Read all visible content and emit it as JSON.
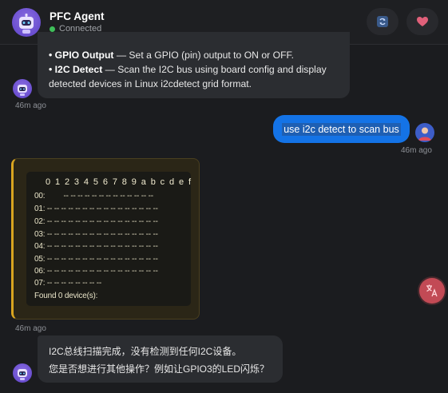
{
  "header": {
    "title": "PFC Agent",
    "status": "Connected",
    "status_color": "#3fbf5a",
    "refresh_icon": "refresh-icon",
    "heart_icon": "heart-icon"
  },
  "messages": {
    "bot_intro": {
      "item1_label": "• GPIO Output",
      "item1_text": " — Set a GPIO (pin) output to ON or OFF.",
      "item2_label": "• I2C Detect",
      "item2_text_line1": " — Scan the I2C bus using board config and display",
      "item2_text_line2": "detected devices in Linux i2cdetect grid format.",
      "time": "46m ago"
    },
    "user_msg": {
      "text": "use i2c detect to scan bus",
      "time": "46m ago"
    },
    "tool_result": {
      "header": "0 1 2 3 4 5 6 7 8 9 a b c d e f",
      "rows": [
        "00:         -- -- -- -- -- -- -- -- -- -- -- -- --",
        "01: -- -- -- -- -- -- -- -- -- -- -- -- -- -- -- --",
        "02: -- -- -- -- -- -- -- -- -- -- -- -- -- -- -- --",
        "03: -- -- -- -- -- -- -- -- -- -- -- -- -- -- -- --",
        "04: -- -- -- -- -- -- -- -- -- -- -- -- -- -- -- --",
        "05: -- -- -- -- -- -- -- -- -- -- -- -- -- -- -- --",
        "06: -- -- -- -- -- -- -- -- -- -- -- -- -- -- -- --",
        "07: -- -- -- -- -- -- -- --"
      ],
      "found": "Found 0 device(s):",
      "time": "46m ago"
    },
    "bot_reply": {
      "line1": "I2C总线扫描完成，没有检测到任何I2C设备。",
      "line2": "您是否想进行其他操作？例如让GPIO3的LED闪烁？"
    }
  },
  "translate_button": {
    "icon": "translate-icon",
    "color": "#c24a55"
  }
}
